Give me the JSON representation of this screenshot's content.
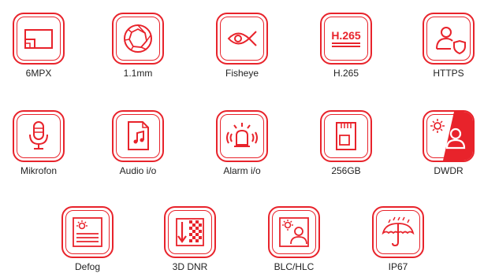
{
  "accent_color": "#e8232b",
  "features": [
    {
      "label": "6MPX",
      "icon": "resolution-icon"
    },
    {
      "label": "1.1mm",
      "icon": "aperture-lens-icon"
    },
    {
      "label": "Fisheye",
      "icon": "fisheye-eye-icon"
    },
    {
      "label": "H.265",
      "icon": "h265-codec-icon",
      "icon_text": "H.265"
    },
    {
      "label": "HTTPS",
      "icon": "user-shield-icon"
    },
    {
      "label": "Mikrofon",
      "icon": "microphone-icon"
    },
    {
      "label": "Audio i/o",
      "icon": "audio-file-icon"
    },
    {
      "label": "Alarm i/o",
      "icon": "alarm-siren-icon"
    },
    {
      "label": "256GB",
      "icon": "sd-card-icon"
    },
    {
      "label": "DWDR",
      "icon": "dwdr-sun-person-icon"
    },
    {
      "label": "Defog",
      "icon": "defog-sun-icon"
    },
    {
      "label": "3D DNR",
      "icon": "noise-reduction-icon"
    },
    {
      "label": "BLC/HLC",
      "icon": "backlight-compensation-icon"
    },
    {
      "label": "IP67",
      "icon": "umbrella-rain-icon"
    }
  ]
}
